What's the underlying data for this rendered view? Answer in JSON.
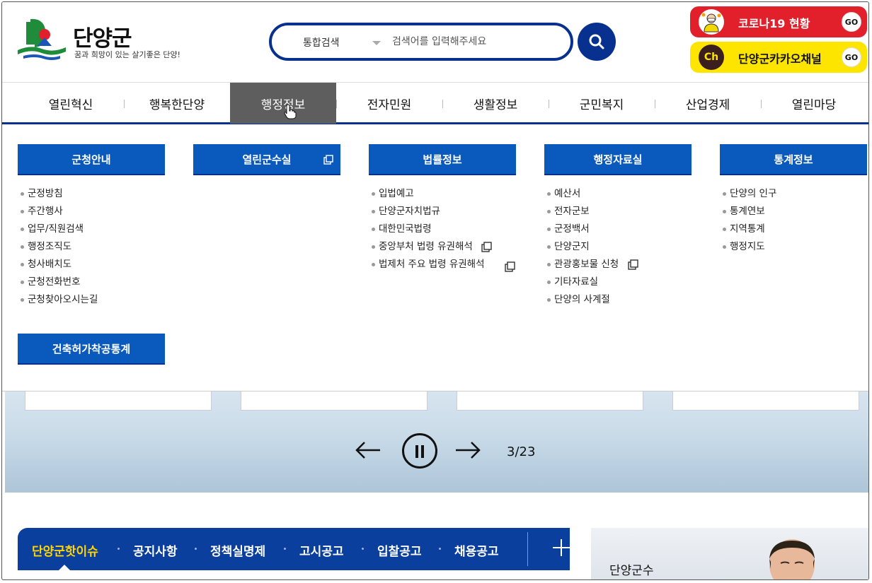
{
  "header": {
    "logo_title": "단양군",
    "logo_slogan": "꿈과 희망이 있는 살기좋은 단양!",
    "search": {
      "type_label": "통합검색",
      "placeholder": "검색어를 입력해주세요"
    },
    "quick_links": [
      {
        "label": "코로나19 현황",
        "go": "GO"
      },
      {
        "label": "단양군카카오채널",
        "icon_text": "Ch",
        "go": "GO"
      }
    ]
  },
  "gnb": {
    "items": [
      "열린혁신",
      "행복한단양",
      "행정정보",
      "전자민원",
      "생활정보",
      "군민복지",
      "산업경제",
      "열린마당"
    ],
    "active_index": 2
  },
  "mega_menu": {
    "columns": [
      {
        "title": "군청안내",
        "items": [
          "군정방침",
          "주간행사",
          "업무/직원검색",
          "행정조직도",
          "청사배치도",
          "군청전화번호",
          "군청찾아오시는길"
        ]
      },
      {
        "title": "열린군수실",
        "items": []
      },
      {
        "title": "법률정보",
        "items": [
          "입법예고",
          "단양군자치법규",
          "대한민국법령",
          "중앙부처 법령 유권해석",
          "법제처 주요 법령 유권해석"
        ]
      },
      {
        "title": "행정자료실",
        "items": [
          "예산서",
          "전자군보",
          "군정백서",
          "단양군지",
          "관광홍보물 신청",
          "기타자료실",
          "단양의 사계절"
        ]
      },
      {
        "title": "통계정보",
        "items": [
          "단양의 인구",
          "통계연보",
          "지역통계",
          "행정지도"
        ]
      }
    ],
    "extra_title": "건축허가착공통계"
  },
  "hero": {
    "counter": "3/23"
  },
  "news_tabs": {
    "items": [
      "단양군핫이슈",
      "공지사항",
      "정책실명제",
      "고시공고",
      "입찰공고",
      "채용공고"
    ],
    "active_index": 0
  },
  "mayor": {
    "label": "단양군수"
  },
  "colors": {
    "primary_navy": "#08308f",
    "menu_blue": "#0a5abd",
    "covid_red": "#e2202c",
    "kakao_yellow": "#fde500",
    "active_tab_yellow": "#ffd400"
  }
}
